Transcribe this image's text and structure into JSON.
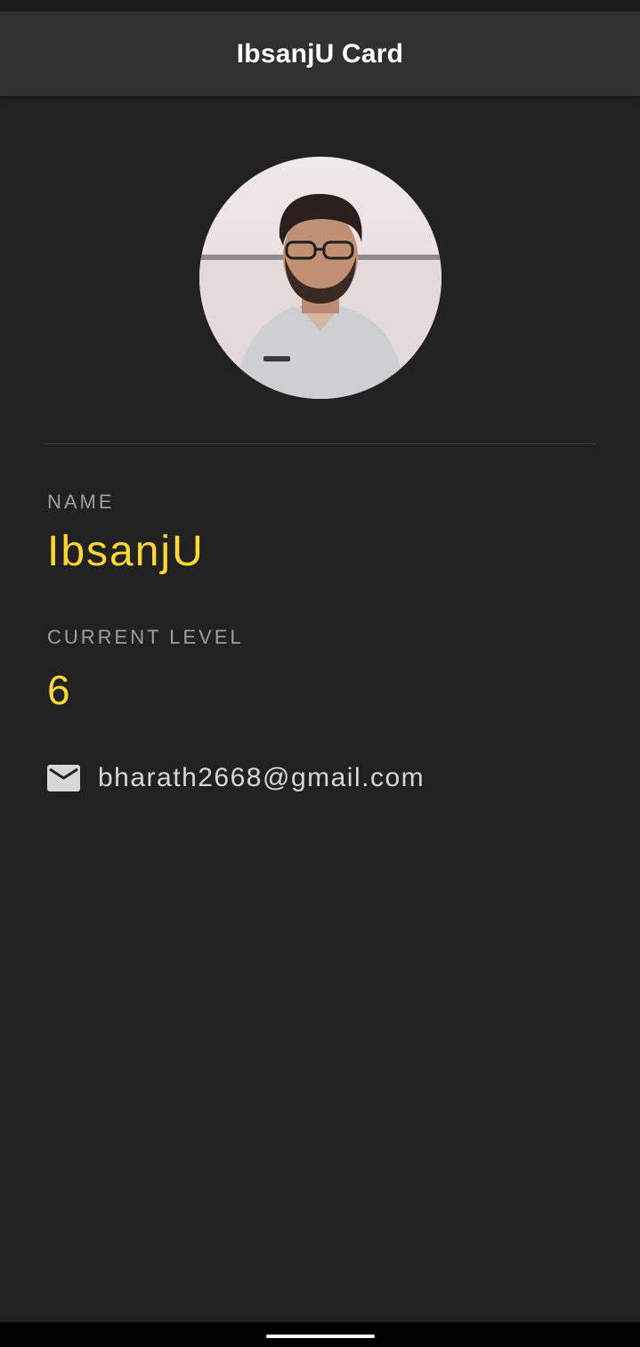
{
  "app_bar": {
    "title": "IbsanjU Card"
  },
  "profile": {
    "avatar_alt": "Profile photo",
    "name_label": "NAME",
    "name": "IbsanjU",
    "level_label": "CURRENT LEVEL",
    "level": "6",
    "email": "bharath2668@gmail.com",
    "email_icon": "mail-icon"
  },
  "colors": {
    "background": "#212121",
    "app_bar": "#303030",
    "accent": "#fdd835",
    "label": "#9e9e9e",
    "email_text": "#d7d7d7"
  }
}
